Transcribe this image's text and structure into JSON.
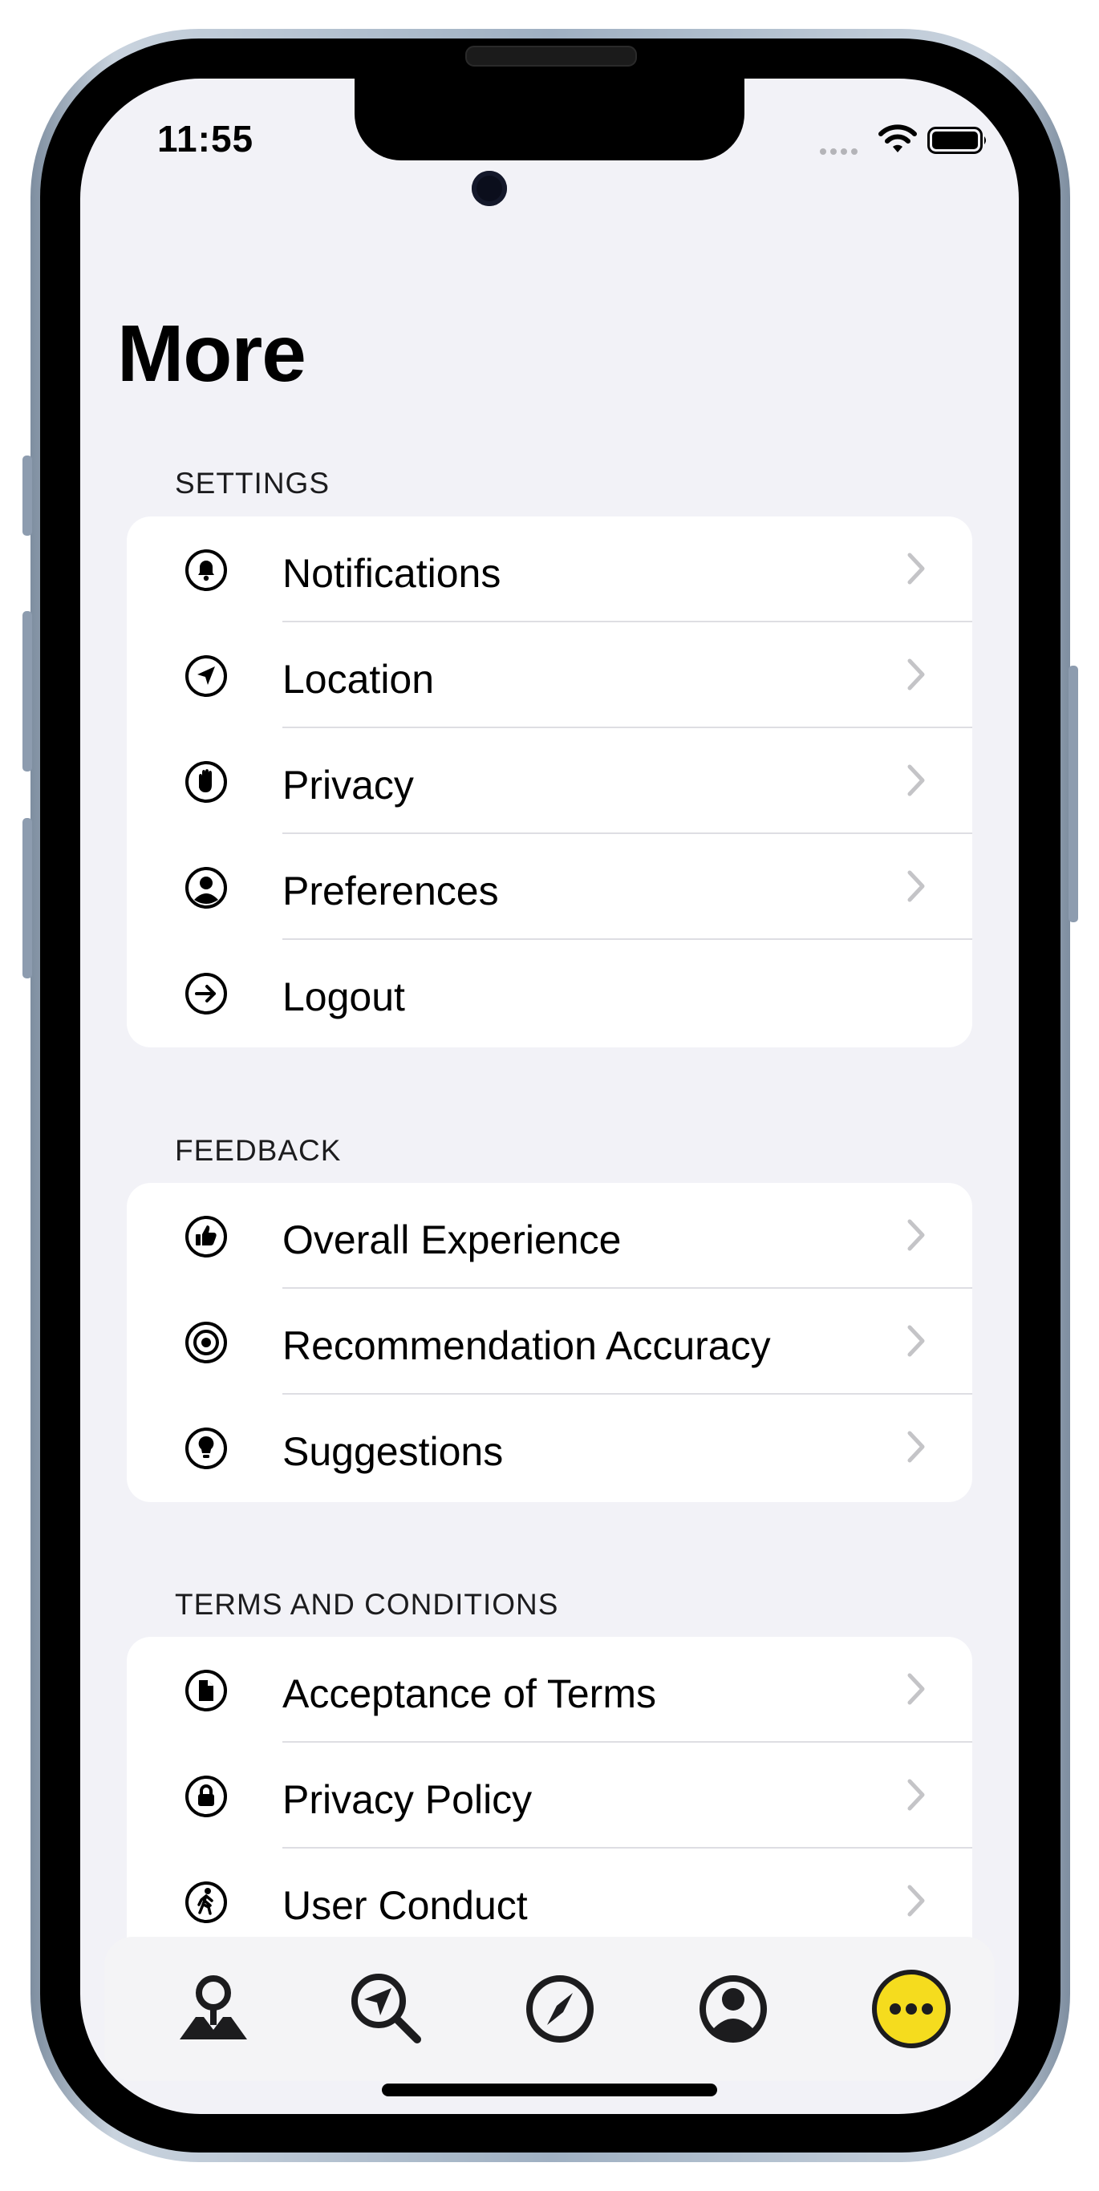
{
  "status_bar": {
    "time": "11:55"
  },
  "page": {
    "title": "More"
  },
  "sections": [
    {
      "header": "SETTINGS",
      "items": [
        {
          "label": "Notifications",
          "icon": "bell-icon",
          "chevron": true
        },
        {
          "label": "Location",
          "icon": "location-arrow-icon",
          "chevron": true
        },
        {
          "label": "Privacy",
          "icon": "hand-raised-icon",
          "chevron": true
        },
        {
          "label": "Preferences",
          "icon": "person-circle-icon",
          "chevron": true
        },
        {
          "label": "Logout",
          "icon": "arrow-right-circle-icon",
          "chevron": false
        }
      ]
    },
    {
      "header": "FEEDBACK",
      "items": [
        {
          "label": "Overall Experience",
          "icon": "thumbs-up-icon",
          "chevron": true
        },
        {
          "label": "Recommendation Accuracy",
          "icon": "target-icon",
          "chevron": true
        },
        {
          "label": "Suggestions",
          "icon": "lightbulb-icon",
          "chevron": true
        }
      ]
    },
    {
      "header": "TERMS AND CONDITIONS",
      "items": [
        {
          "label": "Acceptance of Terms",
          "icon": "document-icon",
          "chevron": true
        },
        {
          "label": "Privacy Policy",
          "icon": "lock-icon",
          "chevron": true
        },
        {
          "label": "User Conduct",
          "icon": "walking-person-icon",
          "chevron": true
        }
      ]
    }
  ],
  "tab_bar": {
    "tabs": [
      {
        "icon": "map-pin-icon",
        "selected": false
      },
      {
        "icon": "search-location-icon",
        "selected": false
      },
      {
        "icon": "compass-icon",
        "selected": false
      },
      {
        "icon": "profile-icon",
        "selected": false
      },
      {
        "icon": "more-ellipsis-icon",
        "selected": true
      }
    ]
  },
  "colors": {
    "accent": "#f5dc1e",
    "background": "#f2f2f7",
    "chevron": "#c4c4c7"
  }
}
